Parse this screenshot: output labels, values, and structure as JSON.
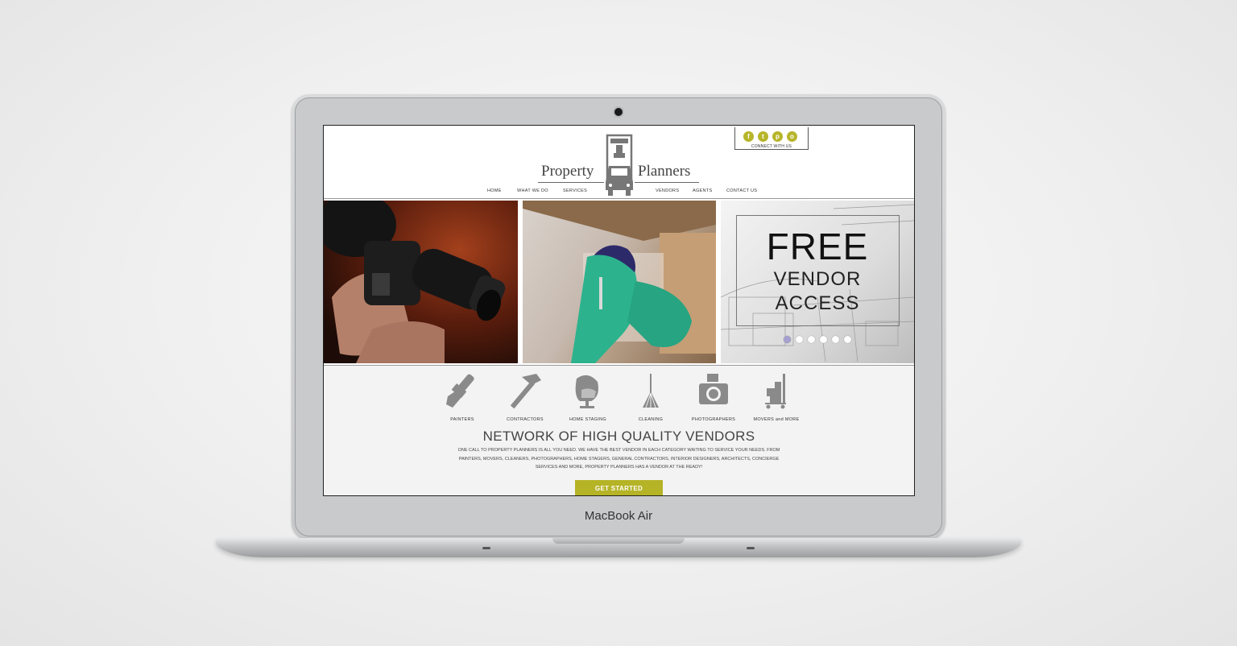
{
  "device_label": "MacBook Air",
  "site": {
    "logo": {
      "left_word": "Property",
      "right_word": "Planners"
    },
    "social": {
      "icons": [
        "facebook-icon",
        "twitter-icon",
        "pinterest-icon",
        "instagram-icon"
      ],
      "glyphs": [
        "f",
        "t",
        "p",
        "o"
      ],
      "label": "CONNECT WITH US"
    },
    "nav": [
      "HOME",
      "WHAT WE DO",
      "SERVICES",
      "VENDORS",
      "AGENTS",
      "CONTACT US"
    ],
    "hero": {
      "line1": "FREE",
      "line2": "VENDOR",
      "line3": "ACCESS",
      "slides": 6,
      "active_slide": 1
    },
    "categories": [
      "PAINTERS",
      "CONTRACTORS",
      "HOME STAGING",
      "CLEANING",
      "PHOTOGRAPHERS",
      "MOVERS and MORE"
    ],
    "network": {
      "title": "NETWORK OF HIGH QUALITY VENDORS",
      "body": "ONE CALL TO PROPERTY PLANNERS IS ALL YOU NEED. WE HAVE THE BEST VENDOR IN EACH CATEGORY WAITING TO SERVICE YOUR NEEDS. FROM PAINTERS, MOVERS, CLEANERS, PHOTOGRAPHERS, HOME STAGERS, GENERAL CONTRACTORS, INTERIOR DESIGNERS, ARCHITECTS, CONCIERGE SERVICES AND MORE, PROPERTY PLANNERS HAS A VENDOR AT THE READY!"
    },
    "cta": "GET STARTED",
    "colors": {
      "accent": "#b5b326",
      "icon_gray": "#8a8a8a",
      "text": "#444444"
    }
  }
}
